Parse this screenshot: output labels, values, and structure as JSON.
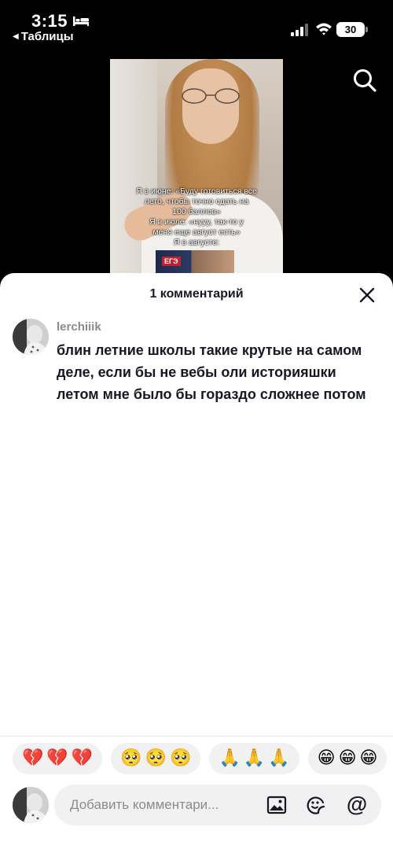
{
  "status_bar": {
    "time": "3:15",
    "back_label": "Таблицы",
    "battery": "30",
    "icons": [
      "bed-icon",
      "signal-icon",
      "wifi-icon",
      "battery-icon"
    ]
  },
  "video": {
    "caption_lines": [
      "Я в июне: «Буду готовиться все",
      "лето, чтобы точно сдать на",
      "100 баллов»",
      "Я в июле: «нууу, так-то у",
      "меня еще август есть»",
      "Я в августе:"
    ],
    "thumb_label": "ЕГЭ"
  },
  "sheet": {
    "title": "1 комментарий",
    "close_icon": "close-icon"
  },
  "comments": [
    {
      "username": "lerchiiik",
      "text": "блин летние школы такие крутые на самом деле, если бы не вебы оли историяшки летом мне было бы гораздо сложнее потом"
    }
  ],
  "reactions": [
    [
      "💔",
      "💔",
      "💔"
    ],
    [
      "🥺",
      "🥺",
      "🥺"
    ],
    [
      "🙏",
      "🙏",
      "🙏"
    ],
    [
      "😁",
      "😁",
      "😁"
    ]
  ],
  "composer": {
    "placeholder": "Добавить комментари...",
    "icons": [
      "image-icon",
      "emoji-icon",
      "mention-icon"
    ],
    "mention_glyph": "@"
  },
  "colors": {
    "primary_text": "#161823",
    "secondary_text": "#8a8b91",
    "pill_background": "#f1f1f2"
  }
}
